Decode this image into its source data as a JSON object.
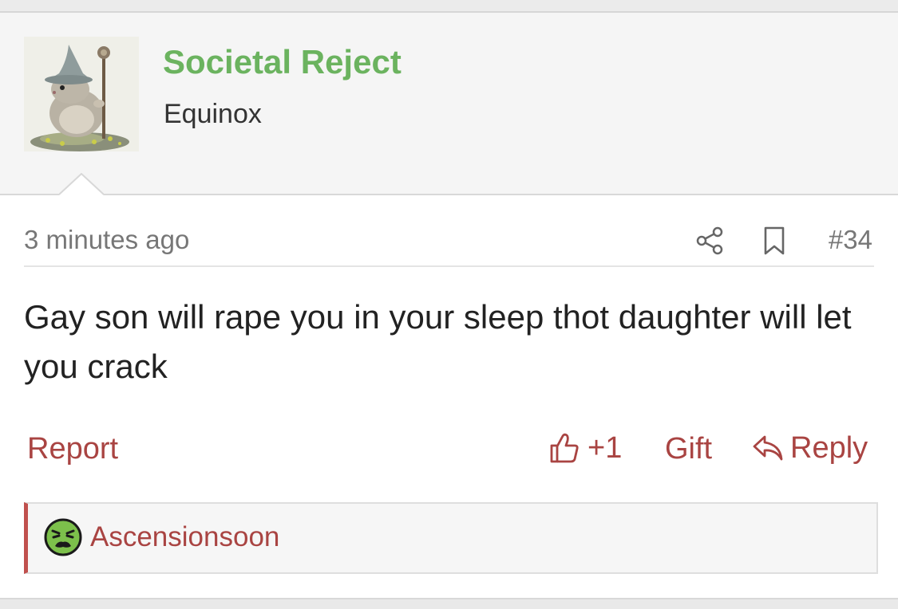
{
  "user": {
    "name": "Societal Reject",
    "title": "Equinox",
    "avatar_icon": "wizard-hamster-avatar"
  },
  "post": {
    "timestamp": "3 minutes ago",
    "number": "#34",
    "text": "Gay son will rape you in your sleep thot daughter will let you crack",
    "share_icon": "share-icon",
    "bookmark_icon": "bookmark-icon"
  },
  "actions": {
    "report_label": "Report",
    "like_count": "+1",
    "gift_label": "Gift",
    "reply_label": "Reply"
  },
  "reaction": {
    "emoji": "nauseated-face",
    "user": "Ascensionsoon"
  },
  "colors": {
    "username": "#6bb35f",
    "link": "#a94442",
    "reaction_border": "#c0504d",
    "emoji_green": "#7cc04b"
  }
}
